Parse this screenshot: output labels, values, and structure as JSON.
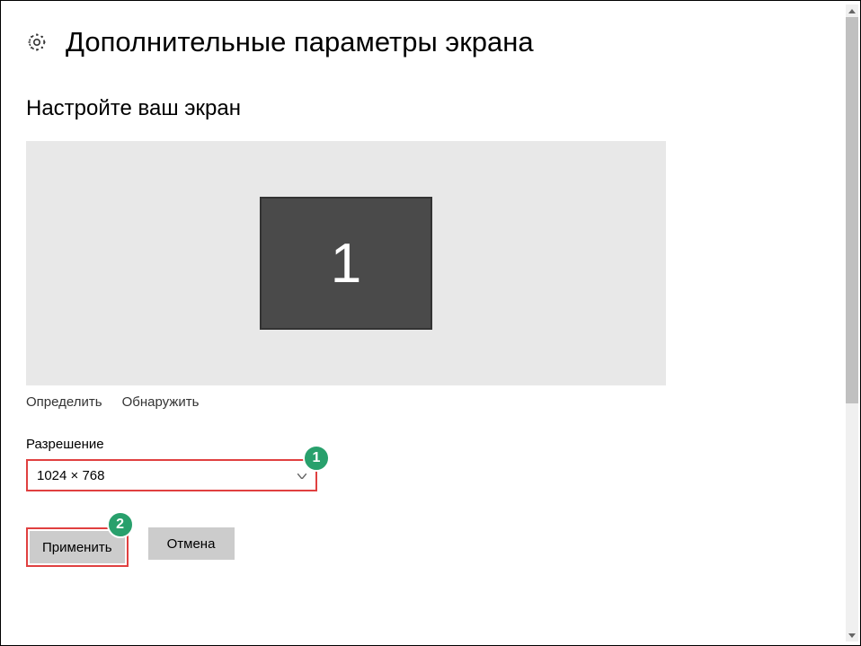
{
  "header": {
    "title": "Дополнительные параметры экрана"
  },
  "section": {
    "title": "Настройте ваш экран"
  },
  "monitor": {
    "number": "1"
  },
  "links": {
    "identify": "Определить",
    "detect": "Обнаружить"
  },
  "resolution": {
    "label": "Разрешение",
    "value": "1024 × 768"
  },
  "buttons": {
    "apply": "Применить",
    "cancel": "Отмена"
  },
  "annotations": {
    "badge1": "1",
    "badge2": "2"
  }
}
